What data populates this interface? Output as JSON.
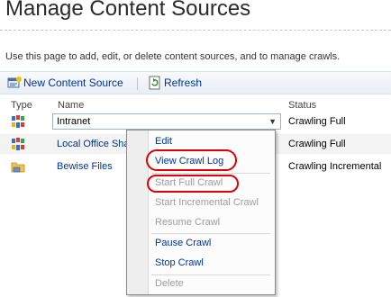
{
  "page": {
    "title": "Manage Content Sources",
    "description": "Use this page to add, edit, or delete content sources, and to manage crawls."
  },
  "toolbar": {
    "new_label": "New Content Source",
    "refresh_label": "Refresh"
  },
  "table": {
    "headers": {
      "type": "Type",
      "name": "Name",
      "status": "Status"
    },
    "rows": [
      {
        "type_icon": "sharepoint-sites-icon",
        "name": "Intranet",
        "status": "Crawling Full"
      },
      {
        "type_icon": "sharepoint-sites-icon",
        "name": "Local Office Sha",
        "status": "Crawling Full"
      },
      {
        "type_icon": "file-share-folder-icon",
        "name": "Bewise Files",
        "status": "Crawling Incremental"
      }
    ]
  },
  "context_menu": {
    "items": [
      {
        "label": "Edit",
        "enabled": true
      },
      {
        "label": "View Crawl Log",
        "enabled": true
      },
      {
        "label": "Start Full Crawl",
        "enabled": false
      },
      {
        "label": "Start Incremental Crawl",
        "enabled": false
      },
      {
        "label": "Resume Crawl",
        "enabled": false
      },
      {
        "label": "Pause Crawl",
        "enabled": true
      },
      {
        "label": "Stop Crawl",
        "enabled": true
      },
      {
        "label": "Delete",
        "enabled": false
      }
    ]
  },
  "colors": {
    "link": "#003399",
    "disabled": "#9c9c9c",
    "highlight_ring": "#e30000"
  }
}
